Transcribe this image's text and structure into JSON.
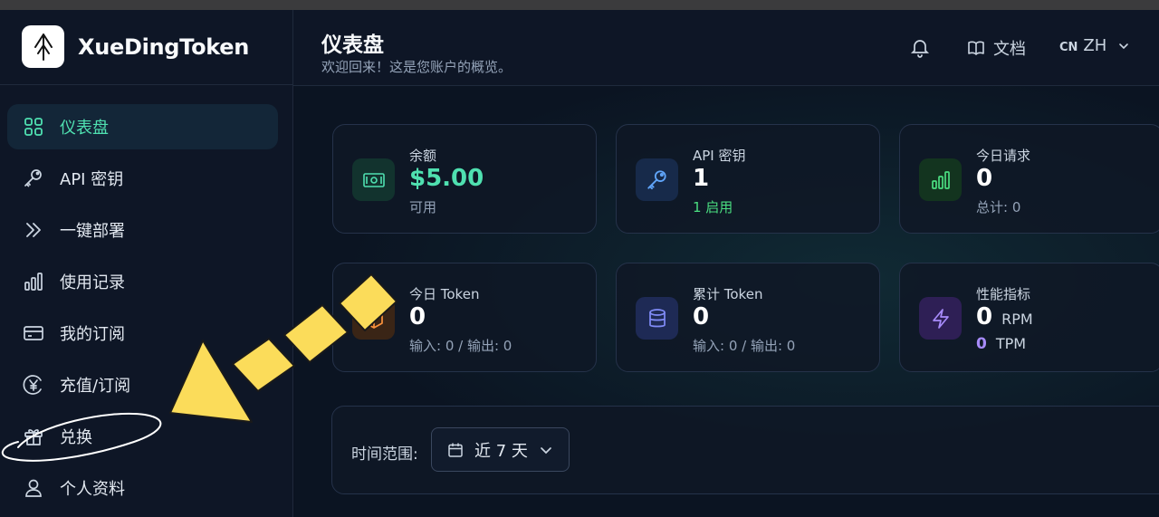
{
  "app": {
    "name": "XueDingToken"
  },
  "sidebar": {
    "items": [
      {
        "label": "仪表盘",
        "icon": "grid-icon",
        "active": true
      },
      {
        "label": "API 密钥",
        "icon": "key-icon"
      },
      {
        "label": "一键部署",
        "icon": "double-chevron-right-icon"
      },
      {
        "label": "使用记录",
        "icon": "bar-chart-icon"
      },
      {
        "label": "我的订阅",
        "icon": "credit-card-icon"
      },
      {
        "label": "充值/订阅",
        "icon": "yen-circle-icon"
      },
      {
        "label": "兑换",
        "icon": "gift-icon"
      },
      {
        "label": "个人资料",
        "icon": "user-icon"
      }
    ]
  },
  "header": {
    "title": "仪表盘",
    "subtitle": "欢迎回来！这是您账户的概览。",
    "docs_label": "文档",
    "lang_flag": "CN",
    "lang_code": "ZH"
  },
  "stats": [
    {
      "label": "余额",
      "value": "$5.00",
      "sub": "可用",
      "icon": "money-icon",
      "value_color": "#4fe0b0"
    },
    {
      "label": "API 密钥",
      "value": "1",
      "sub": "1 启用",
      "icon": "key-icon",
      "sub_color": "#4ade80"
    },
    {
      "label": "今日请求",
      "value": "0",
      "sub": "总计: 0",
      "icon": "bar-chart-icon"
    },
    {
      "label": "今日 Token",
      "value": "0",
      "sub": "输入: 0 / 输出: 0",
      "icon": "cube-icon"
    },
    {
      "label": "累计 Token",
      "value": "0",
      "sub": "输入: 0 / 输出: 0",
      "icon": "database-icon"
    },
    {
      "label": "性能指标",
      "value": "0",
      "unit": "RPM",
      "value2": "0",
      "unit2": "TPM",
      "icon": "bolt-icon"
    }
  ],
  "filter": {
    "label": "时间范围:",
    "range": "近 7 天"
  },
  "colors": {
    "accent": "#4fe0b0",
    "annotation_arrow": "#fbdc5a",
    "background": "#0b1220"
  }
}
